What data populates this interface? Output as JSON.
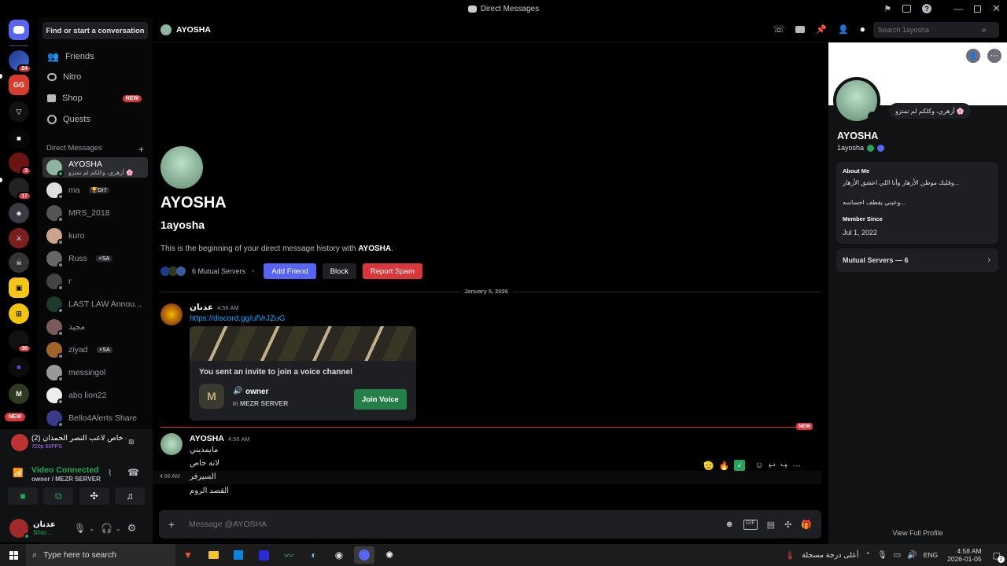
{
  "window": {
    "title": "Direct Messages"
  },
  "guild_badges": {
    "g1": "24",
    "g2": "3",
    "g3": "17",
    "g4": "30",
    "new": "NEW"
  },
  "sidebar": {
    "find_label": "Find or start a conversation",
    "nav": [
      {
        "label": "Friends"
      },
      {
        "label": "Nitro"
      },
      {
        "label": "Shop",
        "badge": "NEW"
      },
      {
        "label": "Quests"
      }
    ],
    "dm_header": "Direct Messages",
    "dms": [
      {
        "name": "AYOSHA",
        "sub": "أزهري، وكلكم لم تمتزو 🌸"
      },
      {
        "name": "ma",
        "tag": "🏆Dr7"
      },
      {
        "name": "MRS_2018"
      },
      {
        "name": "kuro"
      },
      {
        "name": "Russ",
        "tag": "⚡SA"
      },
      {
        "name": "r"
      },
      {
        "name": "LAST LAW Annou..."
      },
      {
        "name": "مجيد"
      },
      {
        "name": "ziyad",
        "tag": "⚡SA"
      },
      {
        "name": "messingol"
      },
      {
        "name": "abo lion22"
      },
      {
        "name": "Bello4Alerts Share"
      }
    ]
  },
  "voice": {
    "stream_title": "(2) بث خاص لاعب النصر الحمدان...",
    "stream_quality": "720p 60FPS",
    "status": "Video Connected",
    "channel": "owner / MEZR SERVER"
  },
  "user": {
    "name": "عدنان",
    "status": "Shar..."
  },
  "header": {
    "name": "AYOSHA",
    "search_placeholder": "Search 1ayosha"
  },
  "intro": {
    "display_name": "AYOSHA",
    "username": "1ayosha",
    "text_before": "This is the beginning of your direct message history with ",
    "text_bold": "AYOSHA",
    "text_after": ".",
    "mutual": "6 Mutual Servers",
    "add_friend": "Add Friend",
    "block": "Block",
    "report": "Report Spam"
  },
  "date_divider": "January 5, 2026",
  "messages": [
    {
      "author": "عدنان",
      "time": "4:56 AM",
      "link": "https://discord.gg/ufVrJZuG",
      "invite": {
        "title": "You sent an invite to join a voice channel",
        "channel": "owner",
        "server_prefix": "in ",
        "server": "MEZR SERVER",
        "button": "Join Voice"
      }
    },
    {
      "author": "AYOSHA",
      "time": "4:56 AM",
      "new_label": "NEW",
      "lines": [
        "مايمديني",
        "لانه خاص",
        "السيرفر",
        "القصد الروم"
      ],
      "side_time": "4:56 AM"
    }
  ],
  "composer": {
    "placeholder": "Message @AYOSHA"
  },
  "profile": {
    "display_name": "AYOSHA",
    "username": "1ayosha",
    "custom_status": "أزهري، وكلكم لم تمتزو 🌸",
    "about_title": "About Me",
    "about_line1": "وقلبك موطن الأزهار وأنا اللي اعشق الأزهار...",
    "about_line2": "وعيني يقطف احساسه...",
    "since_title": "Member Since",
    "since_value": "Jul 1, 2022",
    "mutual_label": "Mutual Servers — 6",
    "view_full": "View Full Profile"
  },
  "taskbar": {
    "search": "Type here to search",
    "weather": "أعلى درجة مسجلة",
    "lang": "ENG",
    "time": "4:58 AM",
    "date": "2026-01-05",
    "notif": "2"
  },
  "colors": {
    "blurple": "#5865f2",
    "green": "#248046",
    "red": "#da373c",
    "link": "#00a8fc"
  }
}
